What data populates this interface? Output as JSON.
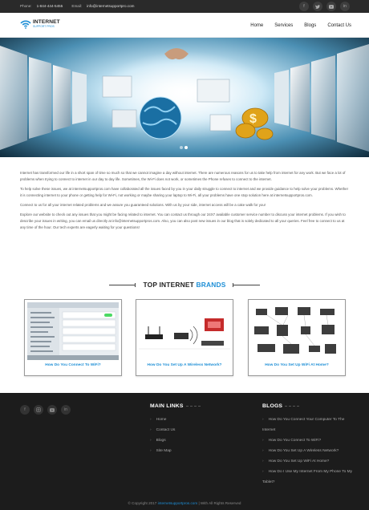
{
  "topbar": {
    "phone_label": "Phone:",
    "phone": "1-844-444-5455",
    "email_label": "Email:",
    "email": "info@internetsupportpro.com",
    "socials": [
      "facebook-icon",
      "twitter-icon",
      "youtube-icon",
      "linkedin-icon"
    ]
  },
  "brand": {
    "name": "INTERNET",
    "tagline": "SUPPORT PROS"
  },
  "nav": {
    "items": [
      "Home",
      "Services",
      "Blogs",
      "Contact Us"
    ]
  },
  "hero": {
    "slides": 2,
    "active_slide": 1
  },
  "content": {
    "paragraphs": [
      "Internet has transformed our life in a short span of time so much so that we cannot imagine a day without internet. There are numerous reasons for us to take help from internet for any work. But we face a lot of problems when trying to connect to internet in our day to day life. Sometimes, the Wi-Fi does not work, or sometimes the Phone refuses to connect to the internet.",
      "To help solve these issues, we at internetsupportpros.com have collaborated all the issues faced by you in your daily struggle to connect to internet and we provide guidance to help solve your problems. Whether it is connecting internet to your phone or getting help for Wi-Fi, not working or maybe sharing your laptop to Wi-Fi, all your problems have one stop solution here at internetsupportpros.com.",
      "Connect to us for all your internet related problems and we assure you guaranteed solutions. With us by your side, internet access will be a cake walk for you!",
      "Explore our website to check out any issues that you might be facing related to internet. You can contact us through our 24X7 available customer service number to discuss your internet problems. If you wish to describe your issues in writing, you can email us directly at info@internetsupportpros.com. Also, you can also post new issues in our blog that is solely dedicated to all your queries. Feel free to connect to us at any time of the hour. Our tech experts are eagerly waiting for your questions!"
    ]
  },
  "brands": {
    "heading_prefix": "TOP INTERNET",
    "heading_accent": "BRANDS",
    "cards": [
      {
        "caption": "How Do You Connect To WiFi?"
      },
      {
        "caption": "How Do You Set Up A Wireless Network?"
      },
      {
        "caption": "How Do You Set Up WiFi At Home?"
      }
    ]
  },
  "footer": {
    "socials": [
      "facebook-icon",
      "instagram-icon",
      "youtube-icon",
      "linkedin-icon"
    ],
    "links_title": "MAIN LINKS",
    "links": [
      "Home",
      "Contact Us",
      "Blogs",
      "Site Map"
    ],
    "blogs_title": "BLOGS",
    "blogs": [
      "How Do You Connect Your Computer To The Internet",
      "How Do You Connect To WiFi?",
      "How Do You Set Up A Wireless Network?",
      "How Do You Set Up WiFi At Home?",
      "How Do I Use My Internet From My Phone To My Tablet?"
    ],
    "copyright_prefix": "© Copyright 2017",
    "copyright_link": "internetsupportpros.com",
    "copyright_suffix": "| With All Rights Reserved"
  },
  "colors": {
    "accent": "#1e8fd6",
    "topbar": "#2a2a2a",
    "footer": "#1c1c1c"
  }
}
